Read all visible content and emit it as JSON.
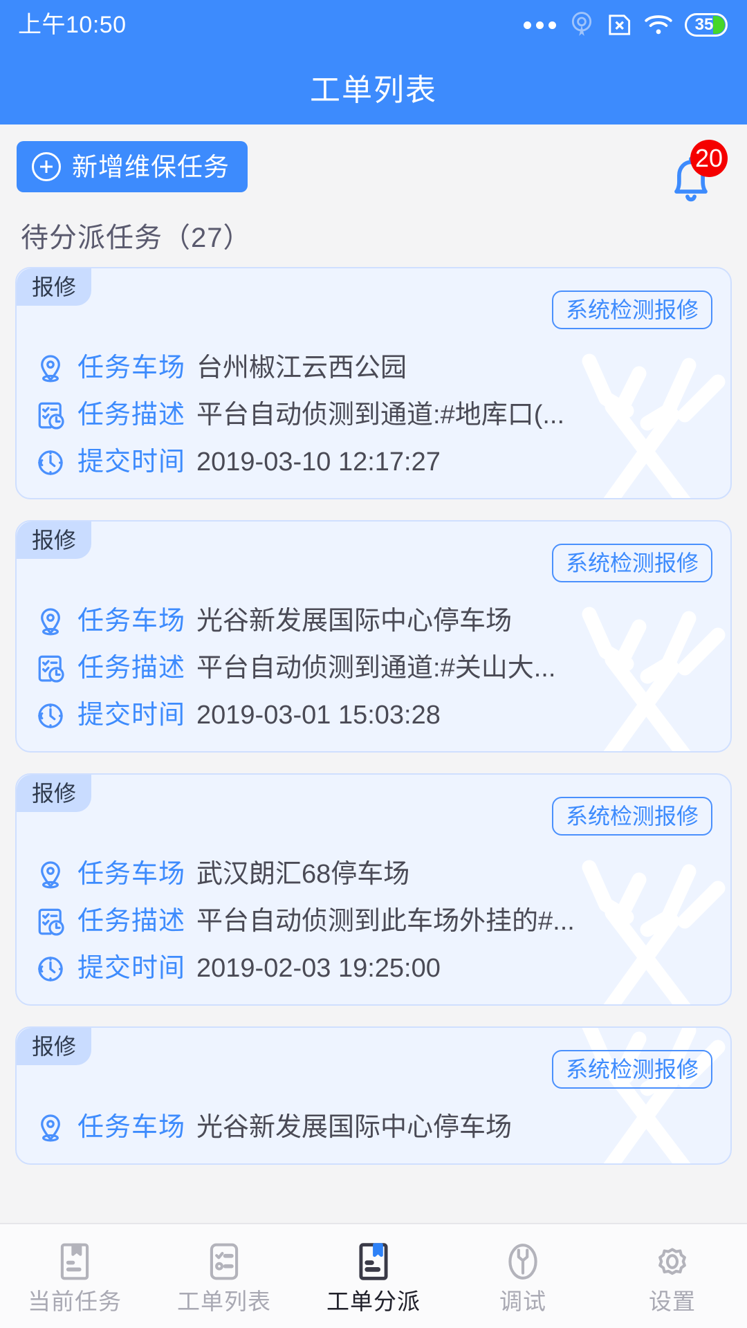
{
  "statusbar": {
    "time": "上午10:50",
    "icons": [
      "more-dots-icon",
      "beacon-icon",
      "sim-card-off-icon",
      "wifi-icon",
      "battery-icon"
    ],
    "battery_level": "35"
  },
  "header": {
    "title": "工单列表",
    "bg_color": "#3d8bfd"
  },
  "toolbar": {
    "add_task_label": "新增维保任务",
    "add_icon": "plus-circle-icon",
    "bell_icon": "bell-icon",
    "bell_badge": "20",
    "badge_color": "#f50000"
  },
  "section": {
    "label": "待分派任务（27）"
  },
  "labels": {
    "site": "任务车场",
    "desc": "任务描述",
    "time": "提交时间",
    "tag": "报修",
    "source": "系统检测报修",
    "site_icon": "location-pin-icon",
    "desc_icon": "checklist-clock-icon",
    "time_icon": "clock-icon",
    "watermark_icon": "wrench-watermark-icon"
  },
  "cards": [
    {
      "tag": "报修",
      "source": "系统检测报修",
      "site": "台州椒江云西公园",
      "desc": "平台自动侦测到通道:#地库口(...",
      "time": "2019-03-10 12:17:27"
    },
    {
      "tag": "报修",
      "source": "系统检测报修",
      "site": "光谷新发展国际中心停车场",
      "desc": "平台自动侦测到通道:#关山大...",
      "time": "2019-03-01 15:03:28"
    },
    {
      "tag": "报修",
      "source": "系统检测报修",
      "site": "武汉朗汇68停车场",
      "desc": "平台自动侦测到此车场外挂的#...",
      "time": "2019-02-03 19:25:00"
    },
    {
      "tag": "报修",
      "source": "系统检测报修",
      "site": "光谷新发展国际中心停车场",
      "desc": "",
      "time": ""
    }
  ],
  "tabbar": {
    "items": [
      {
        "label": "当前任务",
        "icon": "document-bookmark-icon",
        "active": false
      },
      {
        "label": "工单列表",
        "icon": "checklist-icon",
        "active": false
      },
      {
        "label": "工单分派",
        "icon": "document-bookmark-filled-icon",
        "active": true
      },
      {
        "label": "调试",
        "icon": "wrench-circle-icon",
        "active": false
      },
      {
        "label": "设置",
        "icon": "gear-icon",
        "active": false
      }
    ]
  }
}
